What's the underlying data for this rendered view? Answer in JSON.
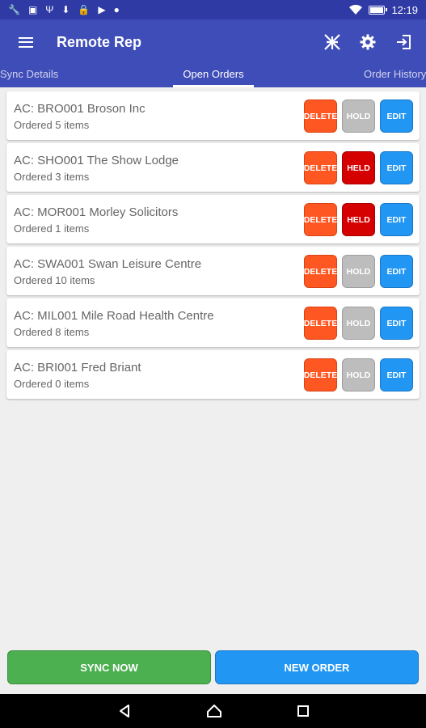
{
  "status_bar": {
    "time": "12:19",
    "battery_level": 0.85,
    "notification_icons": [
      "wrench-icon",
      "image-icon",
      "usb-icon",
      "download-icon",
      "lock-icon",
      "play-store-icon",
      "bulb-icon"
    ]
  },
  "app_bar": {
    "title": "Remote Rep",
    "action_icons": [
      "signal-tower-icon",
      "gear-icon",
      "exit-icon"
    ]
  },
  "tabs": [
    {
      "label": "Sync Details",
      "active": false
    },
    {
      "label": "Open Orders",
      "active": true
    },
    {
      "label": "Order History",
      "active": false
    }
  ],
  "orders": [
    {
      "account": "AC: BRO001 Broson Inc",
      "items": "Ordered 5 items",
      "delete_label": "DELETE",
      "hold_label": "HOLD",
      "held": false,
      "edit_label": "EDIT"
    },
    {
      "account": "AC: SHO001 The Show Lodge",
      "items": "Ordered 3 items",
      "delete_label": "DELETE",
      "hold_label": "HELD",
      "held": true,
      "edit_label": "EDIT"
    },
    {
      "account": "AC: MOR001 Morley Solicitors",
      "items": "Ordered 1 items",
      "delete_label": "DELETE",
      "hold_label": "HELD",
      "held": true,
      "edit_label": "EDIT"
    },
    {
      "account": "AC: SWA001 Swan Leisure Centre",
      "items": "Ordered 10 items",
      "delete_label": "DELETE",
      "hold_label": "HOLD",
      "held": false,
      "edit_label": "EDIT"
    },
    {
      "account": "AC: MIL001 Mile Road Health Centre",
      "items": "Ordered 8 items",
      "delete_label": "DELETE",
      "hold_label": "HOLD",
      "held": false,
      "edit_label": "EDIT"
    },
    {
      "account": "AC: BRI001 Fred Briant",
      "items": "Ordered 0 items",
      "delete_label": "DELETE",
      "hold_label": "HOLD",
      "held": false,
      "edit_label": "EDIT"
    }
  ],
  "footer": {
    "sync_label": "SYNC NOW",
    "new_order_label": "NEW ORDER"
  },
  "colors": {
    "primary": "#3f4db8",
    "primary_dark": "#2f3aa5",
    "delete": "#ff5722",
    "hold": "#bdbdbd",
    "held": "#d50000",
    "edit": "#2196f3",
    "sync": "#4caf50"
  },
  "nav_icons": [
    "back-icon",
    "home-icon",
    "recents-icon"
  ]
}
